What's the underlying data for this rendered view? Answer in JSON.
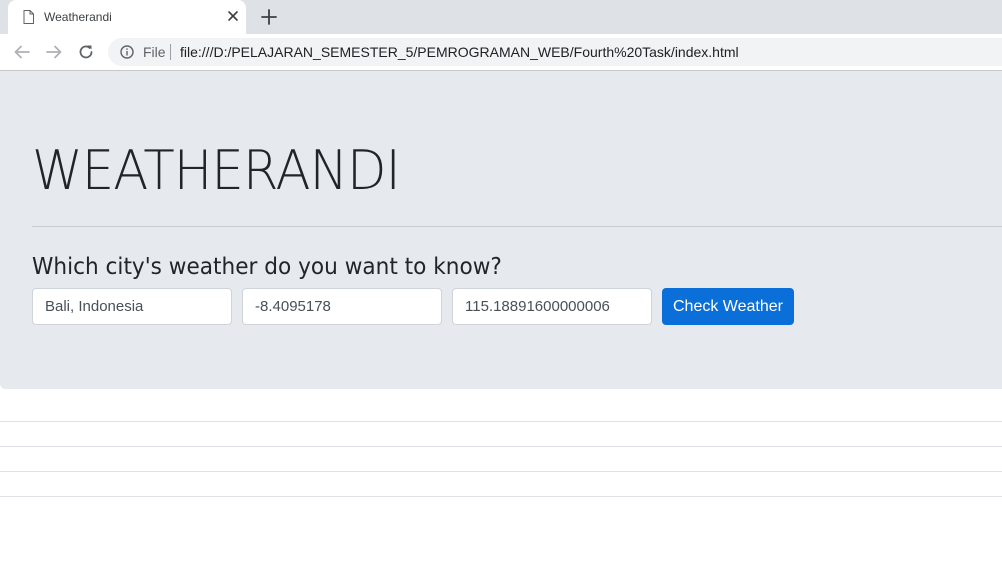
{
  "browser": {
    "tab_title": "Weatherandi",
    "scheme_label": "File",
    "url": "file:///D:/PELAJARAN_SEMESTER_5/PEMROGRAMAN_WEB/Fourth%20Task/index.html",
    "icons": [
      "page-icon",
      "close-icon",
      "plus-icon",
      "back-arrow-icon",
      "forward-arrow-icon",
      "reload-icon",
      "info-icon"
    ]
  },
  "page": {
    "title": "WEATHERANDI",
    "question": "Which city's weather do you want to know?",
    "city_value": "Bali, Indonesia",
    "latitude_value": "-8.4095178",
    "longitude_value": "115.18891600000006",
    "check_button_label": "Check Weather"
  },
  "colors": {
    "jumbotron_bg": "#e6e9ed",
    "button_primary": "#0a6fd8"
  }
}
